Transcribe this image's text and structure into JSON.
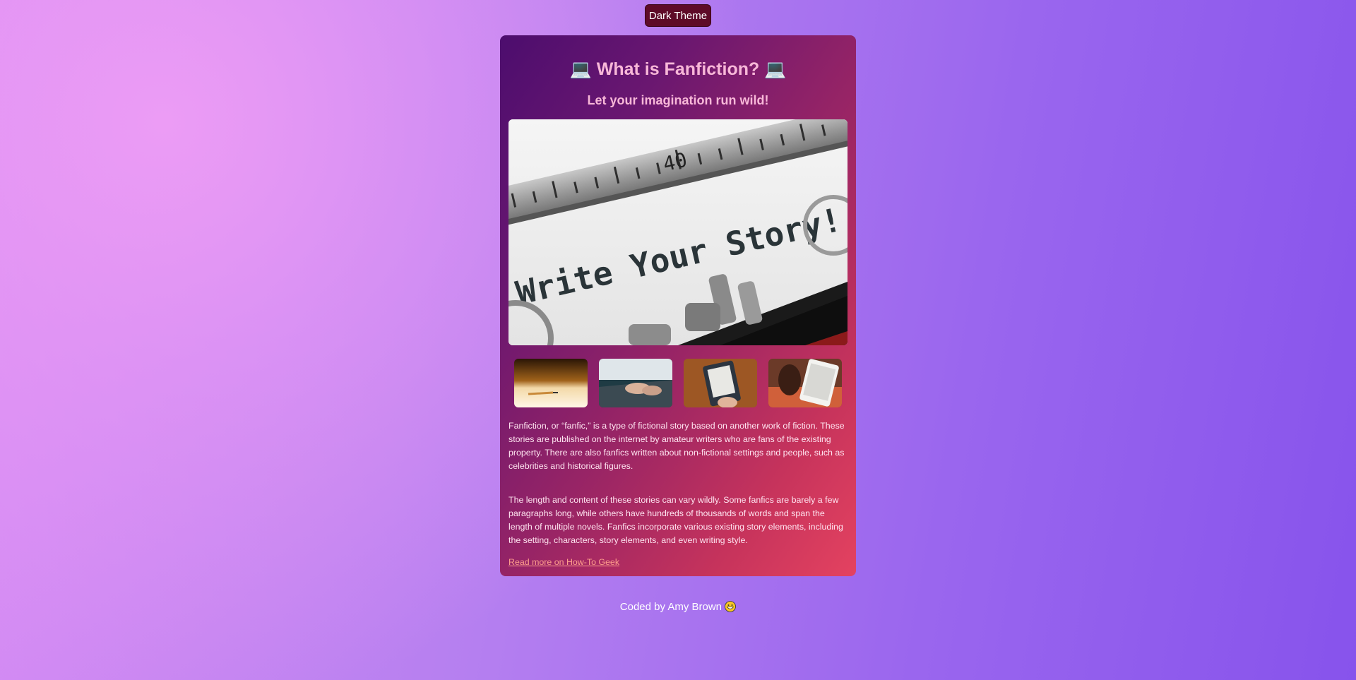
{
  "theme_toggle": {
    "label": "Dark Theme"
  },
  "card": {
    "title": "What is Fanfiction?",
    "title_icon": "laptop-emoji",
    "title_icon_glyph": "💻",
    "subtitle": "Let your imagination run wild!",
    "hero_image": {
      "text": "Write Your Story!",
      "ruler_number": "40"
    },
    "thumbnails": [
      {
        "name": "pencil-paper-photo"
      },
      {
        "name": "laptop-typing-photo"
      },
      {
        "name": "ereader-photo"
      },
      {
        "name": "tablet-reading-photo"
      }
    ],
    "paragraphs": [
      "Fanfiction, or “fanfic,” is a type of fictional story based on another work of fiction. These stories are published on the internet by amateur writers who are fans of the existing property. There are also fanfics written about non-fictional settings and people, such as celebrities and historical figures.",
      "The length and content of these stories can vary wildly. Some fanfics are barely a few paragraphs long, while others have hundreds of thousands of words and span the length of multiple novels. Fanfics incorporate various existing story elements, including the setting, characters, story elements, and even writing style."
    ],
    "read_more": "Read more on How-To Geek"
  },
  "footer": {
    "prefix": "Coded by",
    "author": "Amy Brown",
    "emoji": "grinning-face-icon"
  },
  "colors": {
    "title": "#f8b8d8",
    "theme_button": "#5e0b28",
    "link": "#ffa08c"
  }
}
